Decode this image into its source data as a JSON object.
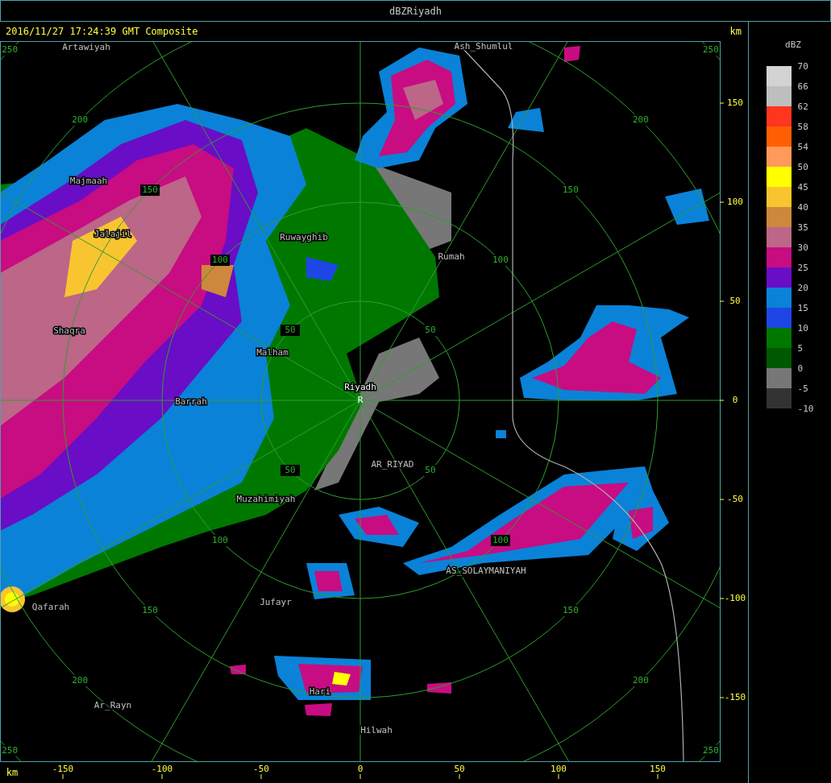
{
  "window": {
    "title": "dBZRiyadh"
  },
  "header": {
    "timestamp": "2016/11/27 17:24:39 GMT Composite",
    "unit": "km"
  },
  "map": {
    "site_marker": "R",
    "places": [
      {
        "name": "Artawiyah",
        "kind": "town"
      },
      {
        "name": "Ash_Shumlul",
        "kind": "town"
      },
      {
        "name": "Majmaah",
        "kind": "town"
      },
      {
        "name": "Jalajil",
        "kind": "town"
      },
      {
        "name": "Shaqra",
        "kind": "town"
      },
      {
        "name": "Ruwayghib",
        "kind": "town"
      },
      {
        "name": "Rumah",
        "kind": "town"
      },
      {
        "name": "Malham",
        "kind": "town"
      },
      {
        "name": "Riyadh",
        "kind": "radar-site"
      },
      {
        "name": "Barrah",
        "kind": "town"
      },
      {
        "name": "AR_RIYAD",
        "kind": "town"
      },
      {
        "name": "Muzahimiyah",
        "kind": "town"
      },
      {
        "name": "AS_SOLAYMANIYAH",
        "kind": "town"
      },
      {
        "name": "Jufayr",
        "kind": "town"
      },
      {
        "name": "Qafarah",
        "kind": "town"
      },
      {
        "name": "Hari",
        "kind": "town"
      },
      {
        "name": "Ar_Rayn",
        "kind": "town"
      },
      {
        "name": "Hilwah",
        "kind": "town"
      }
    ],
    "range_rings": [
      {
        "labels": [
          "50",
          "50",
          "50",
          "50"
        ]
      },
      {
        "labels": [
          "100",
          "100",
          "100",
          "100"
        ]
      },
      {
        "labels": [
          "150",
          "150",
          "150",
          "150"
        ]
      },
      {
        "labels": [
          "200",
          "200",
          "200",
          "200"
        ]
      },
      {
        "labels": [
          "250",
          "250",
          "250",
          "250"
        ]
      }
    ]
  },
  "y_axis": {
    "ticks": [
      "150",
      "100",
      "50",
      "0",
      "-50",
      "-100",
      "-150"
    ]
  },
  "x_axis": {
    "unit": "km",
    "ticks": [
      "-150",
      "-100",
      "-50",
      "0",
      "50",
      "100",
      "150"
    ]
  },
  "legend": {
    "title": "dBZ",
    "labels": [
      "70",
      "66",
      "62",
      "58",
      "54",
      "50",
      "45",
      "40",
      "35",
      "30",
      "25",
      "20",
      "15",
      "10",
      "5",
      "0",
      "-5",
      "-10"
    ],
    "swatches": [
      {
        "color": "#d3d3d3"
      },
      {
        "color": "#bebebe"
      },
      {
        "color": "#ff3520"
      },
      {
        "color": "#ff5f00"
      },
      {
        "color": "#ff9a5a"
      },
      {
        "color": "#ffff00"
      },
      {
        "color": "#f8c531"
      },
      {
        "color": "#cd883c"
      },
      {
        "color": "#bc6688"
      },
      {
        "color": "#c80c82"
      },
      {
        "color": "#6a0dc6"
      },
      {
        "color": "#0a82d8"
      },
      {
        "color": "#1e46e6"
      },
      {
        "color": "#007800"
      },
      {
        "color": "#005800"
      },
      {
        "color": "#777777"
      },
      {
        "color": "#333333"
      }
    ]
  }
}
